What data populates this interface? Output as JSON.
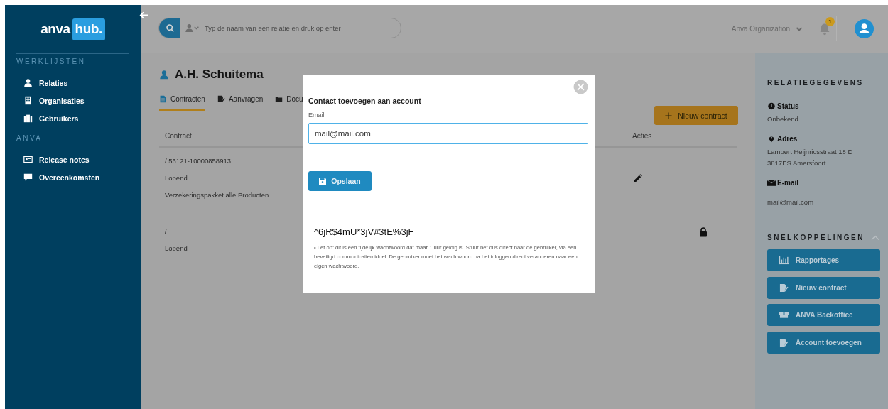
{
  "sidebar": {
    "logo": {
      "left": "anva",
      "right": "hub."
    },
    "sections": [
      {
        "heading": "WERKLIJSTEN",
        "items": [
          {
            "label": "Relaties"
          },
          {
            "label": "Organisaties"
          },
          {
            "label": "Gebruikers"
          }
        ]
      },
      {
        "heading": "ANVA",
        "items": [
          {
            "label": "Release notes"
          },
          {
            "label": "Overeenkomsten"
          }
        ]
      }
    ]
  },
  "topbar": {
    "search_placeholder": "Typ de naam van een relatie en druk op enter",
    "organization": "Anva Organization",
    "notification_count": "1"
  },
  "relation": {
    "name": "A.H. Schuitema"
  },
  "tabs": [
    {
      "label": "Contracten",
      "selected": true
    },
    {
      "label": "Aanvragen",
      "selected": false
    },
    {
      "label": "Docu",
      "selected": false
    }
  ],
  "new_contract_button": "Nieuw contract",
  "table": {
    "columns": [
      "Contract",
      "Acties"
    ],
    "rows": [
      {
        "lines": [
          "/ 56121-10000858913",
          "Lopend",
          "Verzekeringspakket alle Producten"
        ],
        "locked": false
      },
      {
        "lines": [
          "/",
          "Lopend"
        ],
        "locked": true
      }
    ]
  },
  "details": {
    "title": "RELATIEGEGEVENS",
    "fields": [
      {
        "label": "Status",
        "lines": [
          "Onbekend"
        ]
      },
      {
        "label": "Adres",
        "lines": [
          "Lambert Heijnricsstraat 18 D",
          "3817ES Amersfoort"
        ]
      },
      {
        "label": "E-mail",
        "lines": [
          "mail@mail.com"
        ]
      }
    ]
  },
  "shortcuts": {
    "title": "SNELKOPPELINGEN",
    "expanded": true,
    "buttons": [
      {
        "label": "Rapportages"
      },
      {
        "label": "Nieuw contract"
      },
      {
        "label": "ANVA Backoffice"
      },
      {
        "label": "Account toevoegen"
      }
    ]
  },
  "modal": {
    "title": "Contact toevoegen aan account",
    "field_label": "Email",
    "field_value": "mail@mail.com",
    "save_button": "Opslaan",
    "password": "^6jR$4mU*3jV#3tE%3jF",
    "note": "• Let op: dit is een tijdelijk wachtwoord dat maar 1 uur geldig is. Stuur het dus direct naar de gebruiker, via een beveiligd communicatiemiddel. De gebruiker moet het wachtwoord na het inloggen direct veranderen naar een eigen wachtwoord."
  }
}
